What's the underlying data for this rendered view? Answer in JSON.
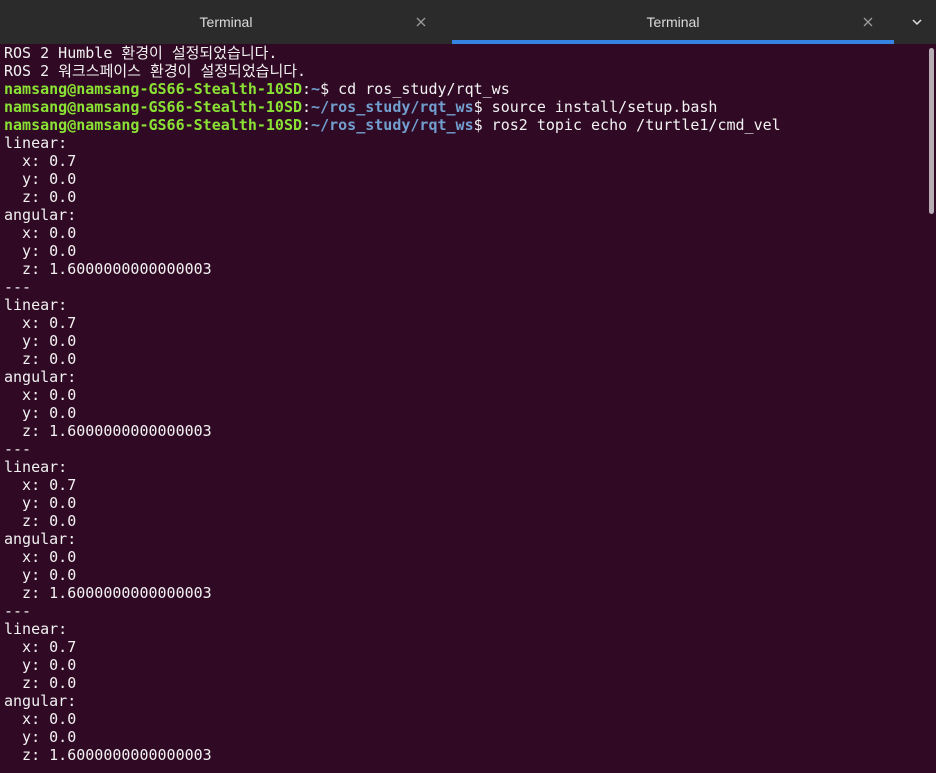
{
  "tabs": [
    {
      "label": "Terminal",
      "active": false
    },
    {
      "label": "Terminal",
      "active": true
    }
  ],
  "terminal": {
    "user_host": "namsang@namsang-GS66-Stealth-10SD",
    "lines": [
      {
        "kind": "text",
        "text": "ROS 2 Humble 환경이 설정되었습니다."
      },
      {
        "kind": "text",
        "text": "ROS 2 워크스페이스 환경이 설정되었습니다."
      },
      {
        "kind": "prompt",
        "path": "~",
        "cmd": "cd ros_study/rqt_ws"
      },
      {
        "kind": "prompt",
        "path": "~/ros_study/rqt_ws",
        "cmd": "source install/setup.bash"
      },
      {
        "kind": "prompt",
        "path": "~/ros_study/rqt_ws",
        "cmd": "ros2 topic echo /turtle1/cmd_vel"
      },
      {
        "kind": "text",
        "text": "linear:"
      },
      {
        "kind": "text",
        "text": "  x: 0.7"
      },
      {
        "kind": "text",
        "text": "  y: 0.0"
      },
      {
        "kind": "text",
        "text": "  z: 0.0"
      },
      {
        "kind": "text",
        "text": "angular:"
      },
      {
        "kind": "text",
        "text": "  x: 0.0"
      },
      {
        "kind": "text",
        "text": "  y: 0.0"
      },
      {
        "kind": "text",
        "text": "  z: 1.6000000000000003"
      },
      {
        "kind": "text",
        "text": "---"
      },
      {
        "kind": "text",
        "text": "linear:"
      },
      {
        "kind": "text",
        "text": "  x: 0.7"
      },
      {
        "kind": "text",
        "text": "  y: 0.0"
      },
      {
        "kind": "text",
        "text": "  z: 0.0"
      },
      {
        "kind": "text",
        "text": "angular:"
      },
      {
        "kind": "text",
        "text": "  x: 0.0"
      },
      {
        "kind": "text",
        "text": "  y: 0.0"
      },
      {
        "kind": "text",
        "text": "  z: 1.6000000000000003"
      },
      {
        "kind": "text",
        "text": "---"
      },
      {
        "kind": "text",
        "text": "linear:"
      },
      {
        "kind": "text",
        "text": "  x: 0.7"
      },
      {
        "kind": "text",
        "text": "  y: 0.0"
      },
      {
        "kind": "text",
        "text": "  z: 0.0"
      },
      {
        "kind": "text",
        "text": "angular:"
      },
      {
        "kind": "text",
        "text": "  x: 0.0"
      },
      {
        "kind": "text",
        "text": "  y: 0.0"
      },
      {
        "kind": "text",
        "text": "  z: 1.6000000000000003"
      },
      {
        "kind": "text",
        "text": "---"
      },
      {
        "kind": "text",
        "text": "linear:"
      },
      {
        "kind": "text",
        "text": "  x: 0.7"
      },
      {
        "kind": "text",
        "text": "  y: 0.0"
      },
      {
        "kind": "text",
        "text": "  z: 0.0"
      },
      {
        "kind": "text",
        "text": "angular:"
      },
      {
        "kind": "text",
        "text": "  x: 0.0"
      },
      {
        "kind": "text",
        "text": "  y: 0.0"
      },
      {
        "kind": "text",
        "text": "  z: 1.6000000000000003"
      }
    ]
  },
  "colors": {
    "background": "#300a24",
    "tabbar": "#2b2b2b",
    "active_tab_indicator": "#3584e4",
    "prompt_user": "#8ae234",
    "prompt_path": "#729fcf",
    "text": "#f2f2f2"
  },
  "icons": {
    "tab_close": "close-icon",
    "tab_menu": "chevron-down-icon"
  }
}
